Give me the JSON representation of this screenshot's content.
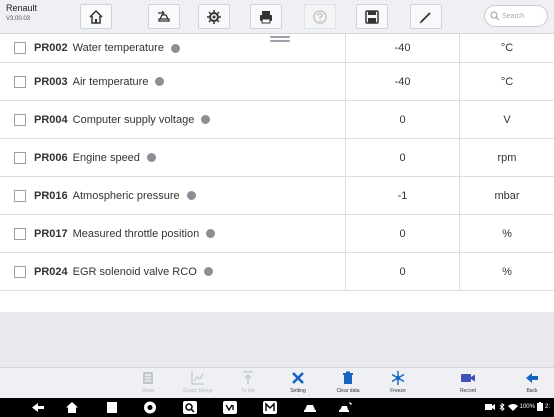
{
  "brand": {
    "name": "Renault",
    "version": "V3.00.03"
  },
  "toolbar": {
    "search_placeholder": "Search"
  },
  "rows": [
    {
      "code": "PR002",
      "name": "Water temperature",
      "value": "-40",
      "unit": "°C"
    },
    {
      "code": "PR003",
      "name": "Air temperature",
      "value": "-40",
      "unit": "°C"
    },
    {
      "code": "PR004",
      "name": "Computer supply voltage",
      "value": "0",
      "unit": "V"
    },
    {
      "code": "PR006",
      "name": "Engine speed",
      "value": "0",
      "unit": "rpm"
    },
    {
      "code": "PR016",
      "name": "Atmospheric pressure",
      "value": "-1",
      "unit": "mbar"
    },
    {
      "code": "PR017",
      "name": "Measured throttle position",
      "value": "0",
      "unit": "%"
    },
    {
      "code": "PR024",
      "name": "EGR solenoid valve RCO",
      "value": "0",
      "unit": "%"
    }
  ],
  "bottom": {
    "show": "Show",
    "graph_merge": "Graph Merge",
    "to_top": "To top",
    "setting": "Setting",
    "clear_data": "Clear data",
    "freeze": "Freeze",
    "record": "Record",
    "back": "Back"
  },
  "status": {
    "battery": "100%",
    "time": "2:"
  },
  "colors": {
    "accent": "#1565c0",
    "topbar": "#eef0f3",
    "record": "#3f51b5"
  }
}
